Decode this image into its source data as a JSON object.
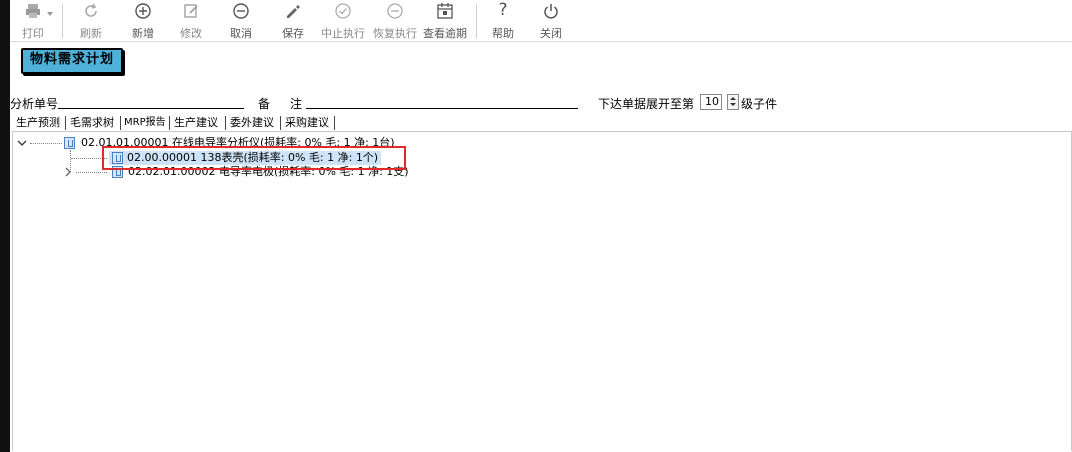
{
  "toolbar": {
    "print": "打印",
    "refresh": "刷新",
    "add": "新增",
    "edit": "修改",
    "cancel": "取消",
    "save": "保存",
    "suspend": "中止执行",
    "resume": "恢复执行",
    "overdue": "查看逾期",
    "help": "帮助",
    "close": "关闭",
    "help_glyph": "?"
  },
  "page_title": "物料需求计划",
  "form": {
    "analysis_no_label": "分析单号",
    "remark_label_1": "备",
    "remark_label_2": "注",
    "expand_label": "下达单据展开至第",
    "expand_level": "10",
    "expand_suffix": "级子件"
  },
  "tabs": [
    "生产预测",
    "毛需求树",
    "MRP报告",
    "生产建议",
    "委外建议",
    "采购建议"
  ],
  "tree": {
    "root": "02.01.01.00001 在线电导率分析仪(损耗率: 0% 毛: 1 净: 1台)",
    "child1": "02.00.00001 138表壳(损耗率: 0% 毛: 1 净: 1个)",
    "child2": "02.02.01.00002 电导率电极(损耗率: 0% 毛: 1 净: 1支)"
  },
  "colors": {
    "accent": "#4fb1d8",
    "highlight": "#e12b2b",
    "selection": "#cde3f7"
  },
  "icons": [
    "print-icon",
    "refresh-icon",
    "plus-circle-icon",
    "edit-icon",
    "minus-circle-icon",
    "save-icon",
    "check-circle-icon",
    "minus-circle-icon",
    "calendar-icon",
    "help-icon",
    "power-icon"
  ]
}
